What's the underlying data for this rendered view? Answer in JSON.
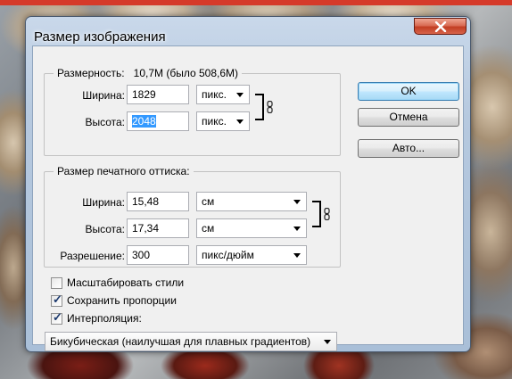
{
  "dialog": {
    "title": "Размер изображения",
    "close_icon": "close-icon"
  },
  "pixel_dims": {
    "legend": "Размерность:",
    "value": "10,7M (было 508,6M)",
    "width_label": "Ширина:",
    "width_value": "1829",
    "width_unit": "пикс.",
    "height_label": "Высота:",
    "height_value": "2048",
    "height_unit": "пикс."
  },
  "print_size": {
    "legend": "Размер печатного оттиска:",
    "width_label": "Ширина:",
    "width_value": "15,48",
    "width_unit": "см",
    "height_label": "Высота:",
    "height_value": "17,34",
    "height_unit": "см",
    "resolution_label": "Разрешение:",
    "resolution_value": "300",
    "resolution_unit": "пикс/дюйм"
  },
  "buttons": {
    "ok": "OK",
    "cancel": "Отмена",
    "auto": "Авто..."
  },
  "options": {
    "scale_styles": {
      "label": "Масштабировать стили",
      "checked": false
    },
    "constrain_proportions": {
      "label": "Сохранить пропорции",
      "checked": true
    },
    "resample": {
      "label": "Интерполяция:",
      "checked": true
    }
  },
  "resample_method": "Бикубическая (наилучшая для плавных градиентов)",
  "icons": {
    "link": "link-icon",
    "check": "✓"
  },
  "colors": {
    "selection": "#3399ff",
    "close_button": "#c94a30",
    "title_bar": "#b6c9df"
  }
}
